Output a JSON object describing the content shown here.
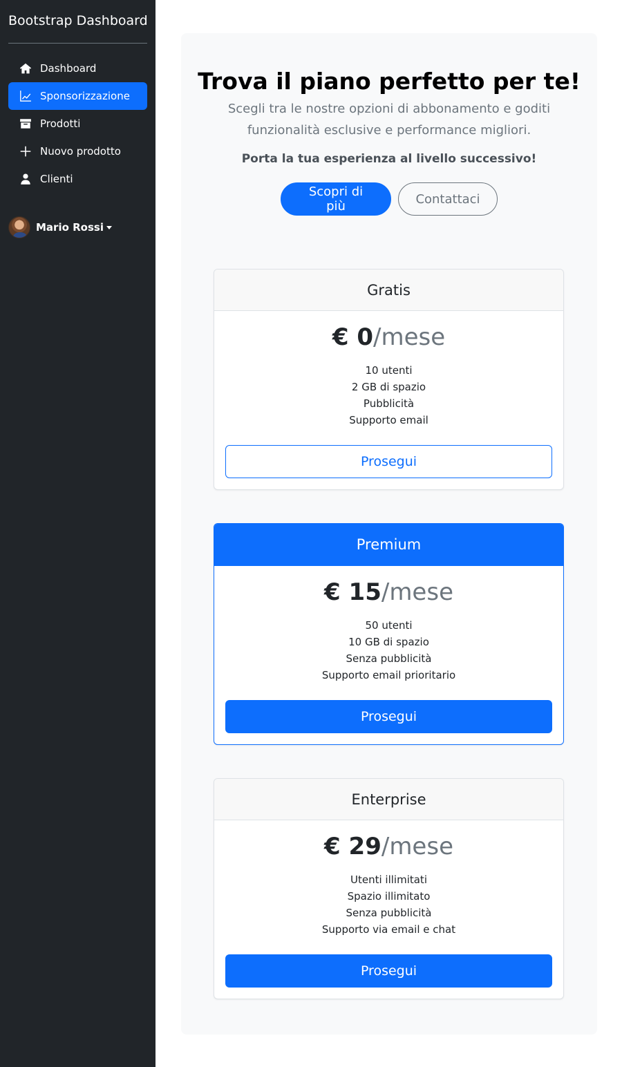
{
  "sidebar": {
    "brand": "Bootstrap Dashboard",
    "items": [
      {
        "label": "Dashboard",
        "icon": "home-icon",
        "active": false
      },
      {
        "label": "Sponsorizzazione",
        "icon": "chart-line-icon",
        "active": true
      },
      {
        "label": "Prodotti",
        "icon": "archive-icon",
        "active": false
      },
      {
        "label": "Nuovo prodotto",
        "icon": "plus-icon",
        "active": false
      },
      {
        "label": "Clienti",
        "icon": "person-icon",
        "active": false
      }
    ],
    "user": {
      "name": "Mario Rossi"
    }
  },
  "hero": {
    "title": "Trova il piano perfetto per te!",
    "lead": "Scegli tra le nostre opzioni di abbonamento e goditi funzionalità esclusive e performance migliori.",
    "cta": "Porta la tua esperienza al livello successivo!",
    "primary_button": "Scopri di più",
    "secondary_button": "Contattaci"
  },
  "plans": [
    {
      "name": "Gratis",
      "currency": "€",
      "price": "0",
      "period": "/mese",
      "features": [
        "10 utenti",
        "2 GB di spazio",
        "Pubblicità",
        "Supporto email"
      ],
      "button": "Prosegui",
      "highlighted": false
    },
    {
      "name": "Premium",
      "currency": "€",
      "price": "15",
      "period": "/mese",
      "features": [
        "50 utenti",
        "10 GB di spazio",
        "Senza pubblicità",
        "Supporto email prioritario"
      ],
      "button": "Prosegui",
      "highlighted": true
    },
    {
      "name": "Enterprise",
      "currency": "€",
      "price": "29",
      "period": "/mese",
      "features": [
        "Utenti illimitati",
        "Spazio illimitato",
        "Senza pubblicità",
        "Supporto via email e chat"
      ],
      "button": "Prosegui",
      "highlighted": false
    }
  ],
  "colors": {
    "sidebar_bg": "#212529",
    "accent": "#0d6efd",
    "main_bg": "#f8f9fa"
  }
}
